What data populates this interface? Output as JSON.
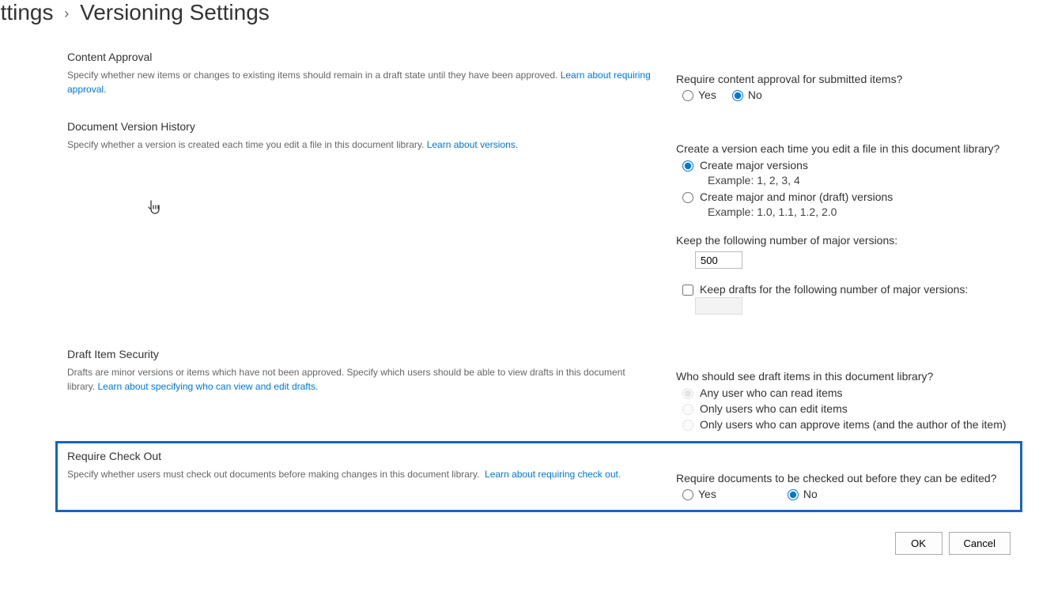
{
  "breadcrumb": {
    "prev": "ettings",
    "current": "Versioning Settings"
  },
  "sections": {
    "contentApproval": {
      "title": "Content Approval",
      "desc": "Specify whether new items or changes to existing items should remain in a draft state until they have been approved.",
      "link": "Learn about requiring approval.",
      "question": "Require content approval for submitted items?",
      "yes": "Yes",
      "no": "No"
    },
    "versionHistory": {
      "title": "Document Version History",
      "desc": "Specify whether a version is created each time you edit a file in this document library.",
      "link": "Learn about versions.",
      "question": "Create a version each time you edit a file in this document library?",
      "optMajor": "Create major versions",
      "exMajor": "Example: 1, 2, 3, 4",
      "optMinor": "Create major and minor (draft) versions",
      "exMinor": "Example: 1.0, 1.1, 1.2, 2.0",
      "keepMajor": "Keep the following number of major versions:",
      "keepMajorValue": "500",
      "keepDrafts": "Keep drafts for the following number of major versions:"
    },
    "draftSecurity": {
      "title": "Draft Item Security",
      "desc": "Drafts are minor versions or items which have not been approved. Specify which users should be able to view drafts in this document library.",
      "link": "Learn about specifying who can view and edit drafts.",
      "question": "Who should see draft items in this document library?",
      "optRead": "Any user who can read items",
      "optEdit": "Only users who can edit items",
      "optApprove": "Only users who can approve items (and the author of the item)"
    },
    "requireCheckout": {
      "title": "Require Check Out",
      "desc": "Specify whether users must check out documents before making changes in this document library.",
      "link": "Learn about requiring check out.",
      "question": "Require documents to be checked out before they can be edited?",
      "yes": "Yes",
      "no": "No"
    }
  },
  "buttons": {
    "ok": "OK",
    "cancel": "Cancel"
  }
}
